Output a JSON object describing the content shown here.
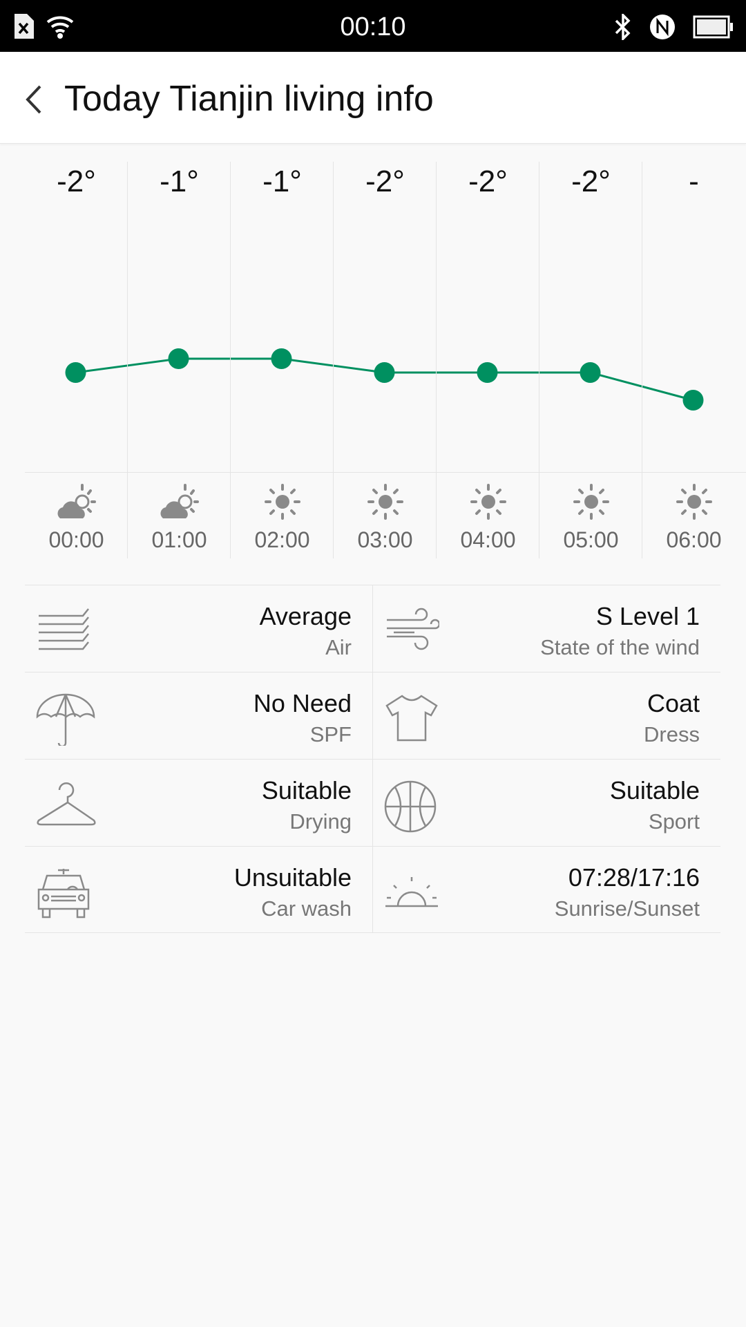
{
  "status_bar": {
    "time": "00:10"
  },
  "header": {
    "title": "Today Tianjin living info"
  },
  "chart_data": {
    "type": "line",
    "line_color": "#009060",
    "categories": [
      "00:00",
      "01:00",
      "02:00",
      "03:00",
      "04:00",
      "05:00",
      "06:00"
    ],
    "temps_label": [
      "-2°",
      "-1°",
      "-1°",
      "-2°",
      "-2°",
      "-2°",
      "-"
    ],
    "values": [
      -2,
      -1,
      -1,
      -2,
      -2,
      -2,
      -4
    ],
    "weather": [
      "partly-cloudy",
      "partly-cloudy",
      "sunny",
      "sunny",
      "sunny",
      "sunny",
      "sunny"
    ]
  },
  "living": [
    {
      "value": "Average",
      "label": "Air",
      "icon": "haze-icon"
    },
    {
      "value": "S Level 1",
      "label": "State of the wind",
      "icon": "wind-icon"
    },
    {
      "value": "No Need",
      "label": "SPF",
      "icon": "umbrella-icon"
    },
    {
      "value": "Coat",
      "label": "Dress",
      "icon": "shirt-icon"
    },
    {
      "value": "Suitable",
      "label": "Drying",
      "icon": "hanger-icon"
    },
    {
      "value": "Suitable",
      "label": "Sport",
      "icon": "basketball-icon"
    },
    {
      "value": "Unsuitable",
      "label": "Car wash",
      "icon": "car-icon"
    },
    {
      "value": "07:28/17:16",
      "label": "Sunrise/Sunset",
      "icon": "sunrise-icon"
    }
  ]
}
